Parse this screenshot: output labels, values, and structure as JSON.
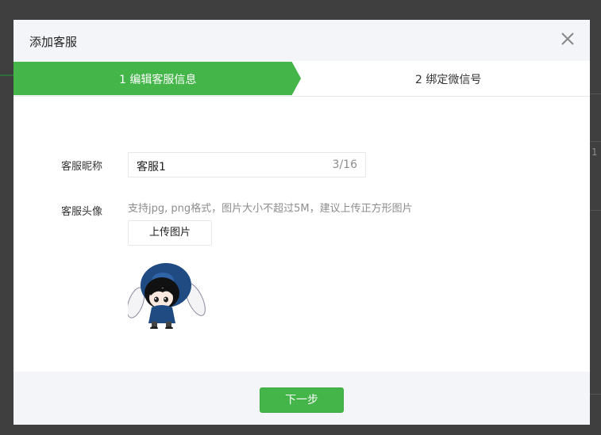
{
  "dialog": {
    "title": "添加客服",
    "close_icon": "close-icon"
  },
  "steps": [
    {
      "label": "1 编辑客服信息",
      "active": true
    },
    {
      "label": "2 绑定微信号",
      "active": false
    }
  ],
  "form": {
    "nickname_label": "客服昵称",
    "nickname_value": "客服1",
    "nickname_counter": "3/16",
    "avatar_label": "客服头像",
    "avatar_hint": "支持jpg, png格式，图片大小不超过5M，建议上传正方形图片",
    "upload_button": "上传图片"
  },
  "footer": {
    "next_button": "下一步"
  },
  "background": {
    "partial_text": "1"
  },
  "colors": {
    "accent": "#44b549",
    "overlay": "#3f3f3f"
  }
}
